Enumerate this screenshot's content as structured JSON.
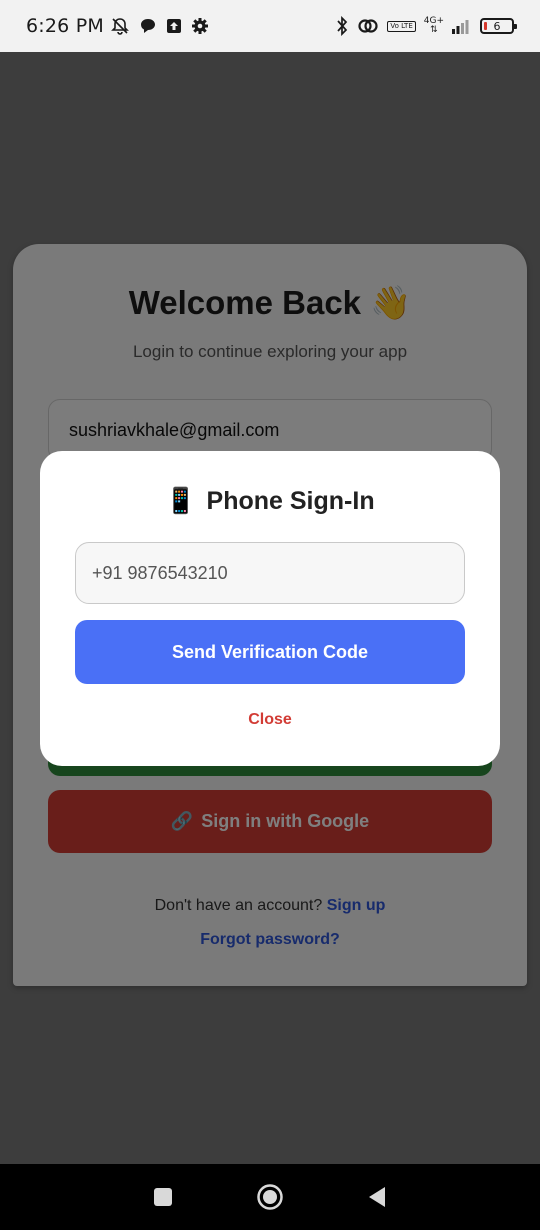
{
  "status_bar": {
    "time": "6:26 PM",
    "network": "4G+",
    "volte_label": "Vo LTE",
    "battery_level": "6",
    "icons": [
      "bell-off-icon",
      "chat-bubble-icon",
      "upload-icon",
      "settings-gear-icon",
      "bluetooth-icon",
      "link-icon",
      "volte-icon",
      "signal-icon",
      "battery-icon"
    ]
  },
  "login": {
    "title": "Welcome Back 👋",
    "subtitle": "Login to continue exploring your app",
    "email_value": "sushriavkhale@gmail.com",
    "google_button": "Sign in with Google",
    "google_icon_glyph": "🔗",
    "signup_prompt": "Don't have an account?",
    "signup_link": "Sign up",
    "forgot_password": "Forgot password?"
  },
  "modal": {
    "title": "Phone Sign-In",
    "title_icon": "📱",
    "phone_placeholder": "+91 9876543210",
    "send_button": "Send Verification Code",
    "close_button": "Close"
  },
  "colors": {
    "primary": "#4a70f6",
    "google": "#d23c35",
    "link": "#2f56d8",
    "success": "#2e8b3a"
  },
  "nav_bar": {
    "icons": [
      "recents-square-icon",
      "home-circle-icon",
      "back-triangle-icon"
    ]
  }
}
